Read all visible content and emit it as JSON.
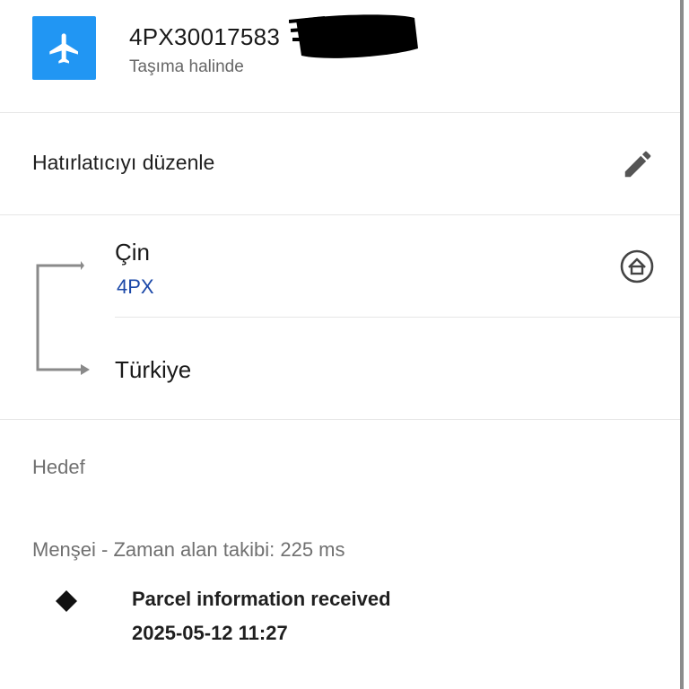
{
  "header": {
    "tracking_number": "4PX30017583",
    "status": "Taşıma halinde"
  },
  "reminder": {
    "label": "Hatırlatıcıyı düzenle"
  },
  "route": {
    "origin": "Çin",
    "carrier": "4PX",
    "destination": "Türkiye"
  },
  "sections": {
    "target_label": "Hedef",
    "origin_label": "Menşei - Zaman alan takibi: 225 ms"
  },
  "events": [
    {
      "title": "Parcel information received",
      "datetime": "2025-05-12 11:27"
    }
  ],
  "colors": {
    "accent": "#2196f3",
    "carrier_link": "#1a47a8"
  },
  "icons": {
    "status": "airplane-icon",
    "edit": "pencil-icon",
    "carrier_home": "home-icon",
    "event_marker": "diamond-icon"
  }
}
